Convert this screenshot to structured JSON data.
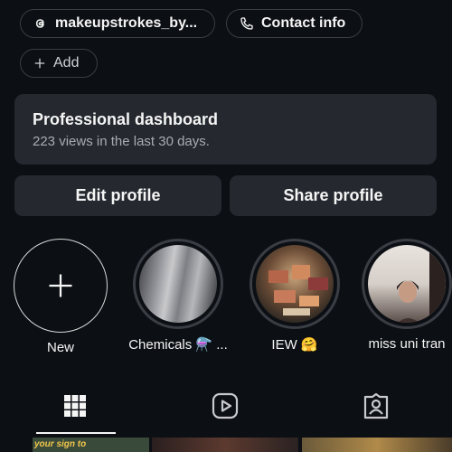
{
  "links": {
    "threads_label": "makeupstrokes_by...",
    "contact_label": "Contact info",
    "add_label": "Add"
  },
  "dashboard": {
    "title": "Professional dashboard",
    "subtitle": "223 views in the last 30 days."
  },
  "actions": {
    "edit_label": "Edit profile",
    "share_label": "Share profile"
  },
  "highlights": [
    {
      "label": "New"
    },
    {
      "label": "Chemicals ⚗️ ..."
    },
    {
      "label": "IEW 🤗"
    },
    {
      "label": "miss uni tran"
    }
  ],
  "tabs": [
    {
      "icon": "grid-icon",
      "active": true
    },
    {
      "icon": "reels-icon",
      "active": false
    },
    {
      "icon": "tagged-icon",
      "active": false
    }
  ],
  "thumb_strip": {
    "first_caption": "your sign to"
  },
  "colors": {
    "background": "#0c0f14",
    "card": "#25292f",
    "border": "#3a3d44",
    "text": "#f5f5f5",
    "muted": "#a8abb2"
  }
}
